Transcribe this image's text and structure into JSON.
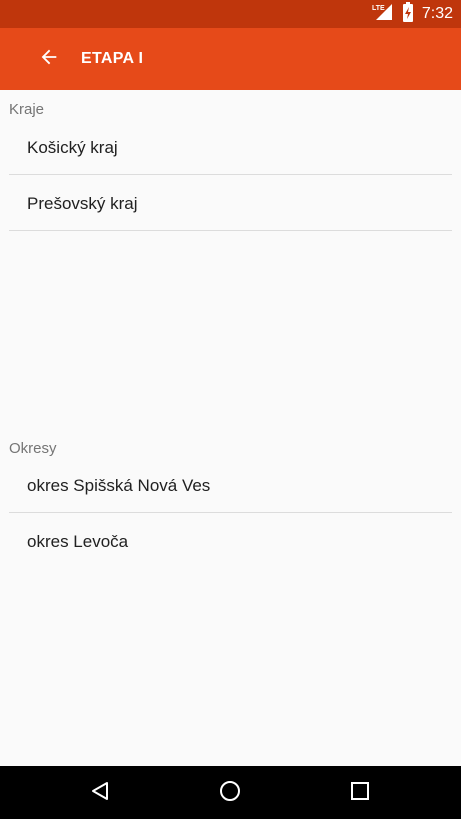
{
  "status_bar": {
    "network_label": "LTE",
    "time": "7:32"
  },
  "app_bar": {
    "title": "ETAPA I",
    "back_icon": "arrow-back-icon"
  },
  "sections": [
    {
      "header": "Kraje",
      "items": [
        "Košický kraj",
        "Prešovský kraj"
      ]
    },
    {
      "header": "Okresy",
      "items": [
        "okres Spišská Nová Ves",
        "okres Levoča"
      ]
    }
  ],
  "nav_bar": {
    "icons": [
      "back-triangle-icon",
      "home-circle-icon",
      "recents-square-icon"
    ]
  },
  "colors": {
    "status_bar": "#bf360c",
    "app_bar": "#e64a19",
    "background": "#fafafa",
    "nav_bar": "#000000"
  }
}
